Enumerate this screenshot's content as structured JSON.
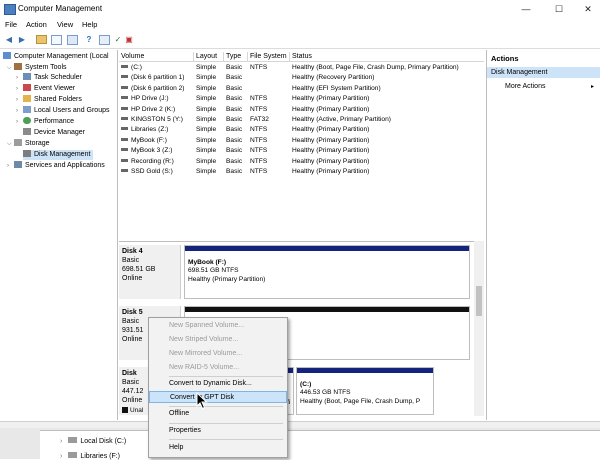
{
  "window": {
    "title": "Computer Management",
    "controls": {
      "minimize": "—",
      "maximize": "☐",
      "close": "✕"
    }
  },
  "menu": [
    "File",
    "Action",
    "View",
    "Help"
  ],
  "toolbar": {
    "icons": [
      "back-icon",
      "forward-icon",
      "up-folder-icon",
      "show-hide-tree-icon",
      "properties-icon",
      "help-icon",
      "connect-icon",
      "check-icon",
      "settings-icon"
    ]
  },
  "tree": {
    "root": "Computer Management (Local",
    "system_tools": "System Tools",
    "task_scheduler": "Task Scheduler",
    "event_viewer": "Event Viewer",
    "shared_folders": "Shared Folders",
    "local_users": "Local Users and Groups",
    "performance": "Performance",
    "device_manager": "Device Manager",
    "storage": "Storage",
    "disk_management": "Disk Management",
    "services": "Services and Applications"
  },
  "volumes": {
    "headers": [
      "Volume",
      "Layout",
      "Type",
      "File System",
      "Status"
    ],
    "rows": [
      [
        "(C:)",
        "Simple",
        "Basic",
        "NTFS",
        "Healthy (Boot, Page File, Crash Dump, Primary Partition)"
      ],
      [
        "(Disk 6 partition 1)",
        "Simple",
        "Basic",
        "",
        "Healthy (Recovery Partition)"
      ],
      [
        "(Disk 6 partition 2)",
        "Simple",
        "Basic",
        "",
        "Healthy (EFI System Partition)"
      ],
      [
        "HP Drive (J:)",
        "Simple",
        "Basic",
        "NTFS",
        "Healthy (Primary Partition)"
      ],
      [
        "HP Drive 2 (K:)",
        "Simple",
        "Basic",
        "NTFS",
        "Healthy (Primary Partition)"
      ],
      [
        "KINGSTON 5 (Y:)",
        "Simple",
        "Basic",
        "FAT32",
        "Healthy (Active, Primary Partition)"
      ],
      [
        "Libraries (Z:)",
        "Simple",
        "Basic",
        "NTFS",
        "Healthy (Primary Partition)"
      ],
      [
        "MyBook (F:)",
        "Simple",
        "Basic",
        "NTFS",
        "Healthy (Primary Partition)"
      ],
      [
        "MyBook 3 (Z:)",
        "Simple",
        "Basic",
        "NTFS",
        "Healthy (Primary Partition)"
      ],
      [
        "Recording (R:)",
        "Simple",
        "Basic",
        "NTFS",
        "Healthy (Primary Partition)"
      ],
      [
        "SSD Gold (S:)",
        "Simple",
        "Basic",
        "NTFS",
        "Healthy (Primary Partition)"
      ]
    ]
  },
  "disks": {
    "disk4": {
      "name": "Disk 4",
      "type": "Basic",
      "size": "698.51 GB",
      "state": "Online",
      "partition": {
        "name": "MyBook (F:)",
        "detail": "698.51 GB NTFS",
        "status": "Healthy (Primary Partition)"
      }
    },
    "disk5": {
      "name": "Disk 5",
      "type": "Basic",
      "size": "931.51",
      "state": "Online"
    },
    "disk6": {
      "name": "Disk",
      "type": "Basic",
      "size": "447.12",
      "state": "Online",
      "partition_fs_tail": "fi",
      "partition_c": {
        "name": "(C:)",
        "detail": "446.53 GB NTFS",
        "status": "Healthy (Boot, Page File, Crash Dump, P"
      }
    },
    "legend_unallocated": "Unal"
  },
  "context_menu": {
    "items": [
      {
        "label": "New Spanned Volume...",
        "enabled": false
      },
      {
        "label": "New Striped Volume...",
        "enabled": false
      },
      {
        "label": "New Mirrored Volume...",
        "enabled": false
      },
      {
        "label": "New RAID-5 Volume...",
        "enabled": false
      },
      {
        "label": "Convert to Dynamic Disk...",
        "enabled": true
      },
      {
        "label": "Convert to GPT Disk",
        "enabled": true,
        "highlighted": true
      },
      {
        "label": "Offline",
        "enabled": true
      },
      {
        "label": "Properties",
        "enabled": true
      },
      {
        "label": "Help",
        "enabled": true
      }
    ]
  },
  "actions": {
    "header": "Actions",
    "section": "Disk Management",
    "more": "More Actions"
  },
  "explorer": {
    "items": [
      "Local Disk (C:)",
      "Libraries (F:)"
    ]
  },
  "colors": {
    "partition_bar": "#14247d",
    "selection": "#cde3f7",
    "menu_highlight": "#cce4f9"
  }
}
